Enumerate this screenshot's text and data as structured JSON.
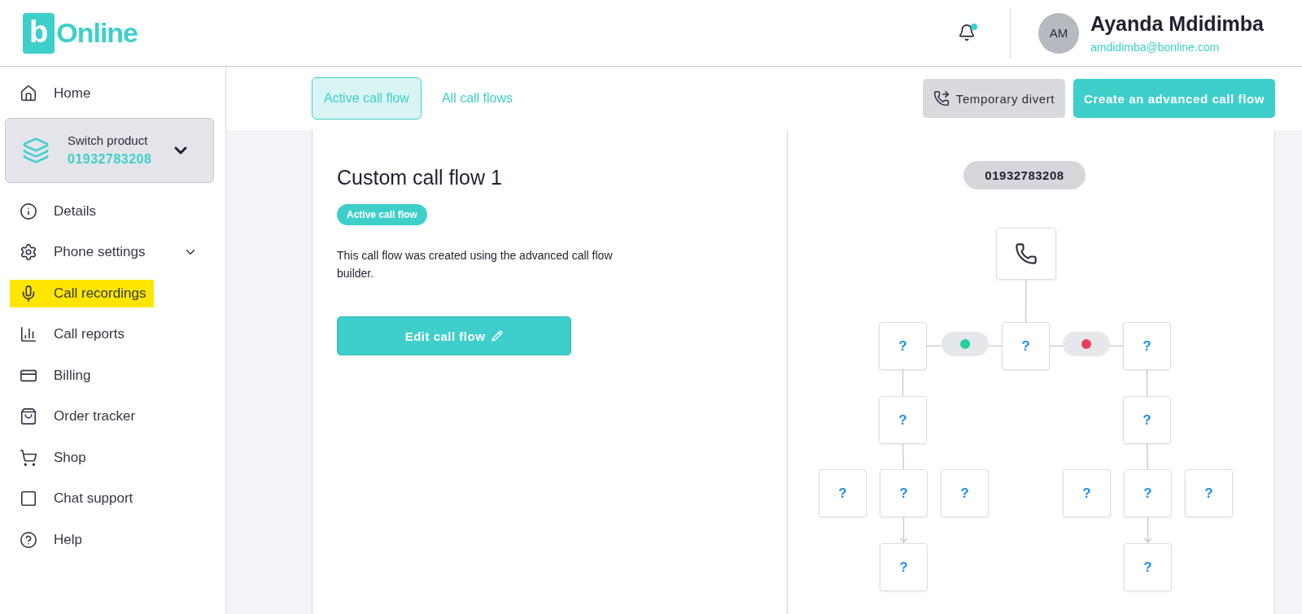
{
  "header": {
    "logo": {
      "mark": "b",
      "text": "Online"
    },
    "user": {
      "initials": "AM",
      "name": "Ayanda Mdidimba",
      "email": "amdidimba@bonline.com"
    }
  },
  "sidebar": {
    "items": [
      {
        "kind": "link",
        "label": "Home",
        "highlighted": false
      },
      {
        "kind": "switcher",
        "label": "Switch product",
        "number": "01932783208"
      },
      {
        "kind": "link",
        "label": "Details",
        "highlighted": false
      },
      {
        "kind": "expandable",
        "label": "Phone settings",
        "expanded": false,
        "highlighted": false
      },
      {
        "kind": "link",
        "label": "Call recordings",
        "highlighted": true
      },
      {
        "kind": "link",
        "label": "Call reports",
        "highlighted": false
      },
      {
        "kind": "link",
        "label": "Billing",
        "highlighted": false
      },
      {
        "kind": "link",
        "label": "Order tracker",
        "highlighted": false
      },
      {
        "kind": "link",
        "label": "Shop",
        "highlighted": false
      },
      {
        "kind": "link",
        "label": "Chat support",
        "highlighted": false
      },
      {
        "kind": "link",
        "label": "Help",
        "highlighted": false
      }
    ]
  },
  "tabs": [
    {
      "label": "Active call flow",
      "selected": true
    },
    {
      "label": "All call flows",
      "selected": false
    }
  ],
  "actions": [
    {
      "kind": "secondary",
      "label": "Temporary divert"
    },
    {
      "kind": "primary",
      "label": "Create an advanced call flow"
    }
  ],
  "flow": {
    "title": "Custom call flow 1",
    "badge": "Active call flow",
    "description": "This call flow was created using the advanced call flow builder.",
    "edit_button": "Edit call flow"
  },
  "diagram": {
    "number": "01932783208",
    "conditions": [
      {
        "color": "#1fcfa3"
      },
      {
        "color": "#e8405a"
      }
    ],
    "nodes": [
      {
        "kind": "phone"
      },
      {
        "kind": "question",
        "label": "?"
      },
      {
        "kind": "question",
        "label": "?"
      },
      {
        "kind": "question",
        "label": "?"
      },
      {
        "kind": "question",
        "label": "?"
      },
      {
        "kind": "question",
        "label": "?"
      },
      {
        "kind": "question",
        "label": "?"
      },
      {
        "kind": "question",
        "label": "?"
      },
      {
        "kind": "question",
        "label": "?"
      },
      {
        "kind": "question",
        "label": "?"
      },
      {
        "kind": "question",
        "label": "?"
      },
      {
        "kind": "question",
        "label": "?"
      },
      {
        "kind": "question",
        "label": "?"
      },
      {
        "kind": "question",
        "label": "?"
      }
    ]
  }
}
